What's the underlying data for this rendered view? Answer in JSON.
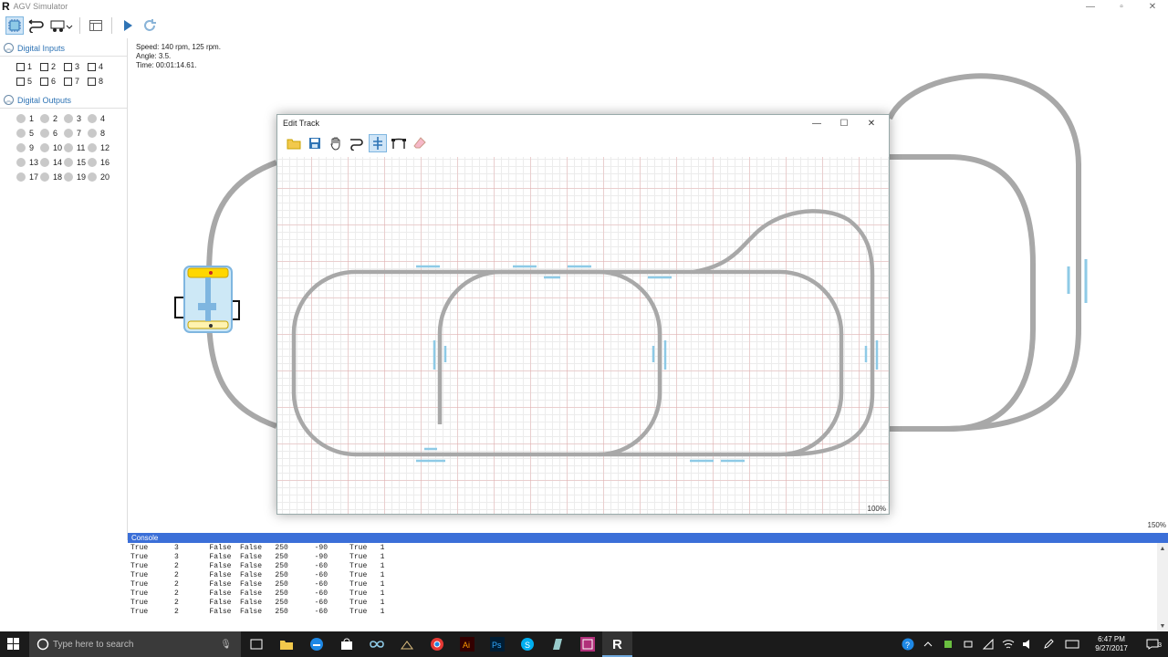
{
  "app": {
    "logo": "R",
    "title": "AGV Simulator",
    "controls": {
      "minimize": "—",
      "maximize": "▫",
      "close": "✕"
    }
  },
  "sidebar": {
    "inputs": {
      "title": "Digital Inputs",
      "items": [
        "1",
        "2",
        "3",
        "4",
        "5",
        "6",
        "7",
        "8"
      ]
    },
    "outputs": {
      "title": "Digital Outputs",
      "items": [
        "1",
        "2",
        "3",
        "4",
        "5",
        "6",
        "7",
        "8",
        "9",
        "10",
        "11",
        "12",
        "13",
        "14",
        "15",
        "16",
        "17",
        "18",
        "19",
        "20"
      ]
    }
  },
  "status": {
    "speed": "Speed: 140 rpm, 125 rpm.",
    "angle": "Angle: 3.5.",
    "time": "Time: 00:01:14.61."
  },
  "canvas": {
    "zoom": "150%"
  },
  "edit_track": {
    "title": "Edit Track",
    "zoom": "100%",
    "controls": {
      "minimize": "—",
      "maximize": "☐",
      "close": "✕"
    }
  },
  "console": {
    "title": "Console",
    "rows": [
      [
        "True",
        "3",
        "False",
        "False",
        "250",
        "-90",
        "True",
        "1"
      ],
      [
        "True",
        "3",
        "False",
        "False",
        "250",
        "-90",
        "True",
        "1"
      ],
      [
        "True",
        "2",
        "False",
        "False",
        "250",
        "-60",
        "True",
        "1"
      ],
      [
        "True",
        "2",
        "False",
        "False",
        "250",
        "-60",
        "True",
        "1"
      ],
      [
        "True",
        "2",
        "False",
        "False",
        "250",
        "-60",
        "True",
        "1"
      ],
      [
        "True",
        "2",
        "False",
        "False",
        "250",
        "-60",
        "True",
        "1"
      ],
      [
        "True",
        "2",
        "False",
        "False",
        "250",
        "-60",
        "True",
        "1"
      ],
      [
        "True",
        "2",
        "False",
        "False",
        "250",
        "-60",
        "True",
        "1"
      ]
    ]
  },
  "taskbar": {
    "search_placeholder": "Type here to search",
    "time": "6:47 PM",
    "date": "9/27/2017",
    "notifications": "3"
  },
  "colors": {
    "track": "#a8a8a8",
    "accent": "#3b6fd8",
    "marker": "#8ecae6",
    "agv_yellow": "#ffd700"
  }
}
